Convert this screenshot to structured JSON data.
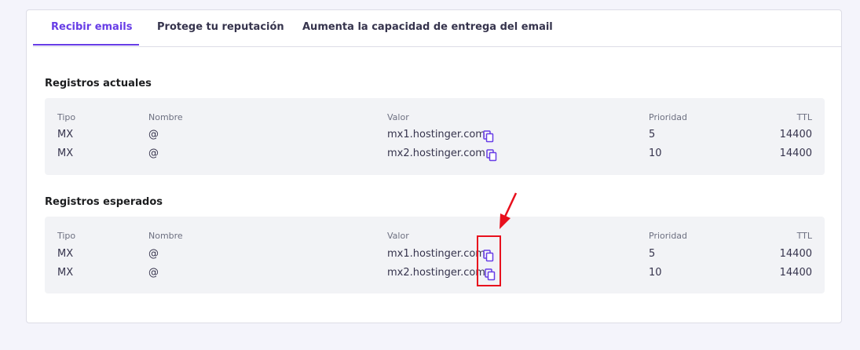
{
  "tabs": [
    {
      "label": "Recibir emails",
      "active": true
    },
    {
      "label": "Protege tu reputación",
      "active": false
    },
    {
      "label": "Aumenta la capacidad de entrega del email",
      "active": false
    }
  ],
  "colors": {
    "accent": "#673de6",
    "annotation": "#e8101d"
  },
  "current": {
    "title": "Registros actuales",
    "headers": {
      "type": "Tipo",
      "name": "Nombre",
      "value": "Valor",
      "priority": "Prioridad",
      "ttl": "TTL"
    },
    "rows": [
      {
        "type": "MX",
        "name": "@",
        "value": "mx1.hostinger.com",
        "priority": "5",
        "ttl": "14400"
      },
      {
        "type": "MX",
        "name": "@",
        "value": "mx2.hostinger.com",
        "priority": "10",
        "ttl": "14400"
      }
    ]
  },
  "expected": {
    "title": "Registros esperados",
    "headers": {
      "type": "Tipo",
      "name": "Nombre",
      "value": "Valor",
      "priority": "Prioridad",
      "ttl": "TTL"
    },
    "rows": [
      {
        "type": "MX",
        "name": "@",
        "value": "mx1.hostinger.com",
        "priority": "5",
        "ttl": "14400"
      },
      {
        "type": "MX",
        "name": "@",
        "value": "mx2.hostinger.com",
        "priority": "10",
        "ttl": "14400"
      }
    ]
  },
  "icons": {
    "copy": "copy-icon",
    "annotation_arrow": "arrow-icon"
  }
}
